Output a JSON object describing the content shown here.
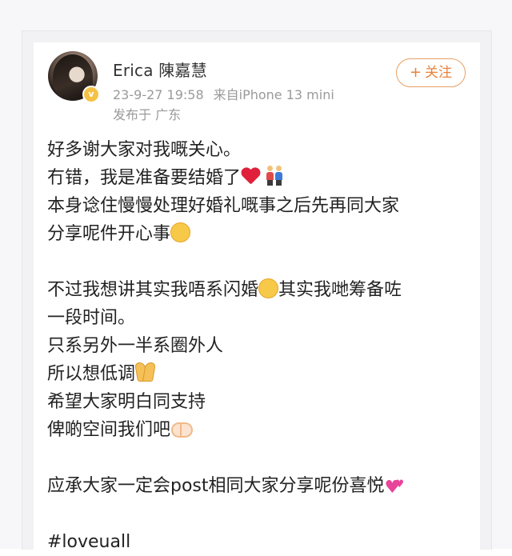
{
  "post": {
    "username": "Erica 陳嘉慧",
    "timestamp": "23-9-27 19:58",
    "source": "来自iPhone 13 mini",
    "location": "发布于 广东",
    "follow_label": "关注",
    "follow_icon": "plus-icon",
    "lines": [
      "好多谢大家对我嘅关心。",
      "冇错，我是准备要结婚了",
      "本身谂住慢慢处理好婚礼嘅事之后先再同大家",
      "分享呢件开心事",
      "",
      "不过我想讲其实我唔系闪婚",
      "其实我哋筹备咗",
      "一段时间。",
      "只系另外一半系圈外人",
      "所以想低调",
      "希望大家明白同支持",
      "俾啲空间我们吧",
      "",
      "应承大家一定会post相同大家分享呢份喜悦",
      "",
      "#loveuall"
    ]
  },
  "colors": {
    "accent": "#e8823a",
    "text": "#222222",
    "meta": "#9a9a9a",
    "verified": "#f6c244"
  }
}
